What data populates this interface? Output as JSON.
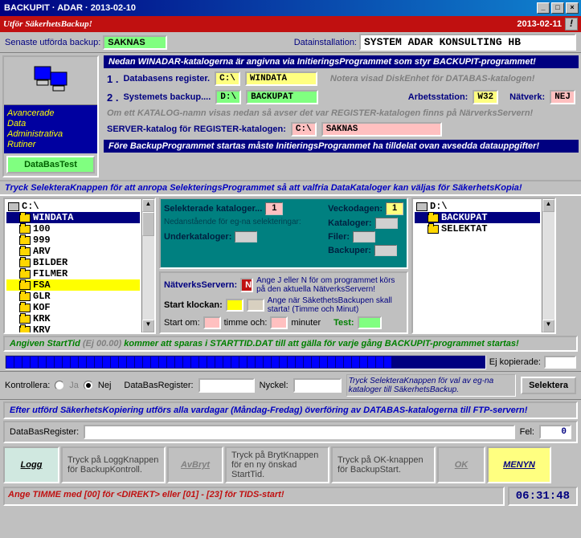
{
  "titlebar": {
    "text": "BACKUPIT · ADAR · 2013-02-10"
  },
  "redbar": {
    "left": "Utför SäkerhetsBackup!",
    "right": "2013-02-11",
    "mark": "!"
  },
  "topinfo": {
    "last_label": "Senaste utförda backup:",
    "last_value": "SAKNAS",
    "install_label": "Datainstallation:",
    "install_value": "SYSTEM ADAR KONSULTING HB"
  },
  "nav": {
    "l1": "Avancerade",
    "l2": "Data",
    "l3": "Administrativa",
    "l4": "Rutiner",
    "btn": "DataBasTest"
  },
  "info1": "Nedan WINADAR-katalogerna är angivna via InitieringsProgrammet som styr BACKUPIT-programmet!",
  "line1": {
    "num": "1 .",
    "label": "Databasens register.",
    "drv": "C:\\",
    "dir": "WINDATA",
    "note": "Notera visad DiskEnhet för DATABAS-katalogen!"
  },
  "line2": {
    "num": "2 .",
    "label": "Systemets backup....",
    "drv": "D:\\",
    "dir": "BACKUPAT",
    "ws_label": "Arbetsstation:",
    "ws": "W32",
    "net_label": "Nätverk:",
    "net": "NEJ"
  },
  "info2": "Om ett KATALOG-namn visas nedan så avser det var REGISTER-katalogen finns på NärverksServern!",
  "server": {
    "label": "SERVER-katalog för REGISTER-katalogen:",
    "drv": "C:\\",
    "val": "SAKNAS"
  },
  "info3": "Före BackupProgrammet startas måste InitieringsProgrammet ha tilldelat ovan avsedda datauppgifter!",
  "info4": "Tryck SelekteraKnappen för att anropa SelekteringsProgrammet så att valfria DataKataloger kan väljas för SäkerhetsKopia!",
  "tree1": {
    "root": "C:\\",
    "items": [
      "WINDATA",
      "100",
      "999",
      "ARV",
      "BILDER",
      "FILMER",
      "FSA",
      "GLR",
      "KOF",
      "KRK",
      "KRV"
    ],
    "sel": "WINDATA",
    "hl": "FSA"
  },
  "tree2": {
    "root": "D:\\",
    "items": [
      "BACKUPAT",
      "SELEKTAT"
    ],
    "sel": "BACKUPAT"
  },
  "teal": {
    "sel_label": "Selekterade kataloger...",
    "sel_val": "1",
    "note": "Nedanstående för eg-na selekteringar:",
    "under_label": "Underkataloger:",
    "day_label": "Veckodagen:",
    "day_val": "1",
    "kat_label": "Kataloger:",
    "fil_label": "Filer:",
    "bak_label": "Backuper:"
  },
  "net": {
    "label": "NätverksServern:",
    "val": "N",
    "txt": "Ange J eller N för om programmet körs på den aktuella NätverksServern!",
    "clock_label": "Start klockan:",
    "clock_txt": "Ange när SäkethetsBackupen skall starta! (Timme och Minut)",
    "start_label": "Start om:",
    "h": "timme och:",
    "m": "minuter",
    "test": "Test:"
  },
  "green1": {
    "a": "Angiven StartTid ",
    "b": "(Ej 00.00) ",
    "c": "kommer att sparas i STARTTID.DAT till att gälla för varje gång BACKUPIT-programmet startas!"
  },
  "prog": {
    "label": "Ej kopierade:"
  },
  "ctrl": {
    "label": "Kontrollera:",
    "ja": "Ja",
    "nej": "Nej",
    "dbr": "DataBasRegister:",
    "key": "Nyckel:",
    "hint": "Tryck SelekteraKnappen för val av eg-na kataloger till SäkerhetsBackup.",
    "btn": "Selektera"
  },
  "info5": "Efter utförd SäkerhetsKopiering utförs alla vardagar (Måndag-Fredag) överföring av DATABAS-katalogerna till FTP-servern!",
  "dbr2": {
    "label": "DataBasRegister:",
    "fel": "Fel:",
    "fel_val": "0"
  },
  "footer": {
    "logg": "Logg",
    "logg_txt": "Tryck på LoggKnappen för BackupKontroll.",
    "avbryt": "AvBryt",
    "bryt_txt": "Tryck på BrytKnappen för en ny önskad StartTid.",
    "ok_txt": "Tryck på OK-knappen för BackupStart.",
    "ok": "OK",
    "meny": "MENYN"
  },
  "status": {
    "msg": "Ange TIMME med [00] för <DIREKT> eller [01] - [23] för TIDS-start!",
    "time": "06:31:48"
  }
}
